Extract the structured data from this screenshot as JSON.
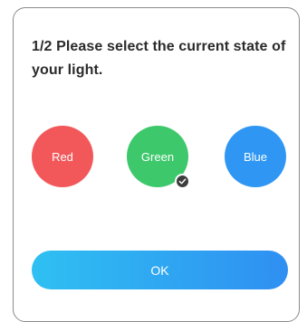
{
  "dialog": {
    "title": "1/2  Please select the current state of your light."
  },
  "options": [
    {
      "label": "Red",
      "color": "#f2585a",
      "selected": false
    },
    {
      "label": "Green",
      "color": "#3ec86c",
      "selected": true
    },
    {
      "label": "Blue",
      "color": "#2f97f3",
      "selected": false
    }
  ],
  "ok_button": {
    "label": "OK",
    "gradient_start": "#2fc0f2",
    "gradient_end": "#2f8ff2"
  },
  "icons": {
    "selected_badge": "check-icon"
  }
}
